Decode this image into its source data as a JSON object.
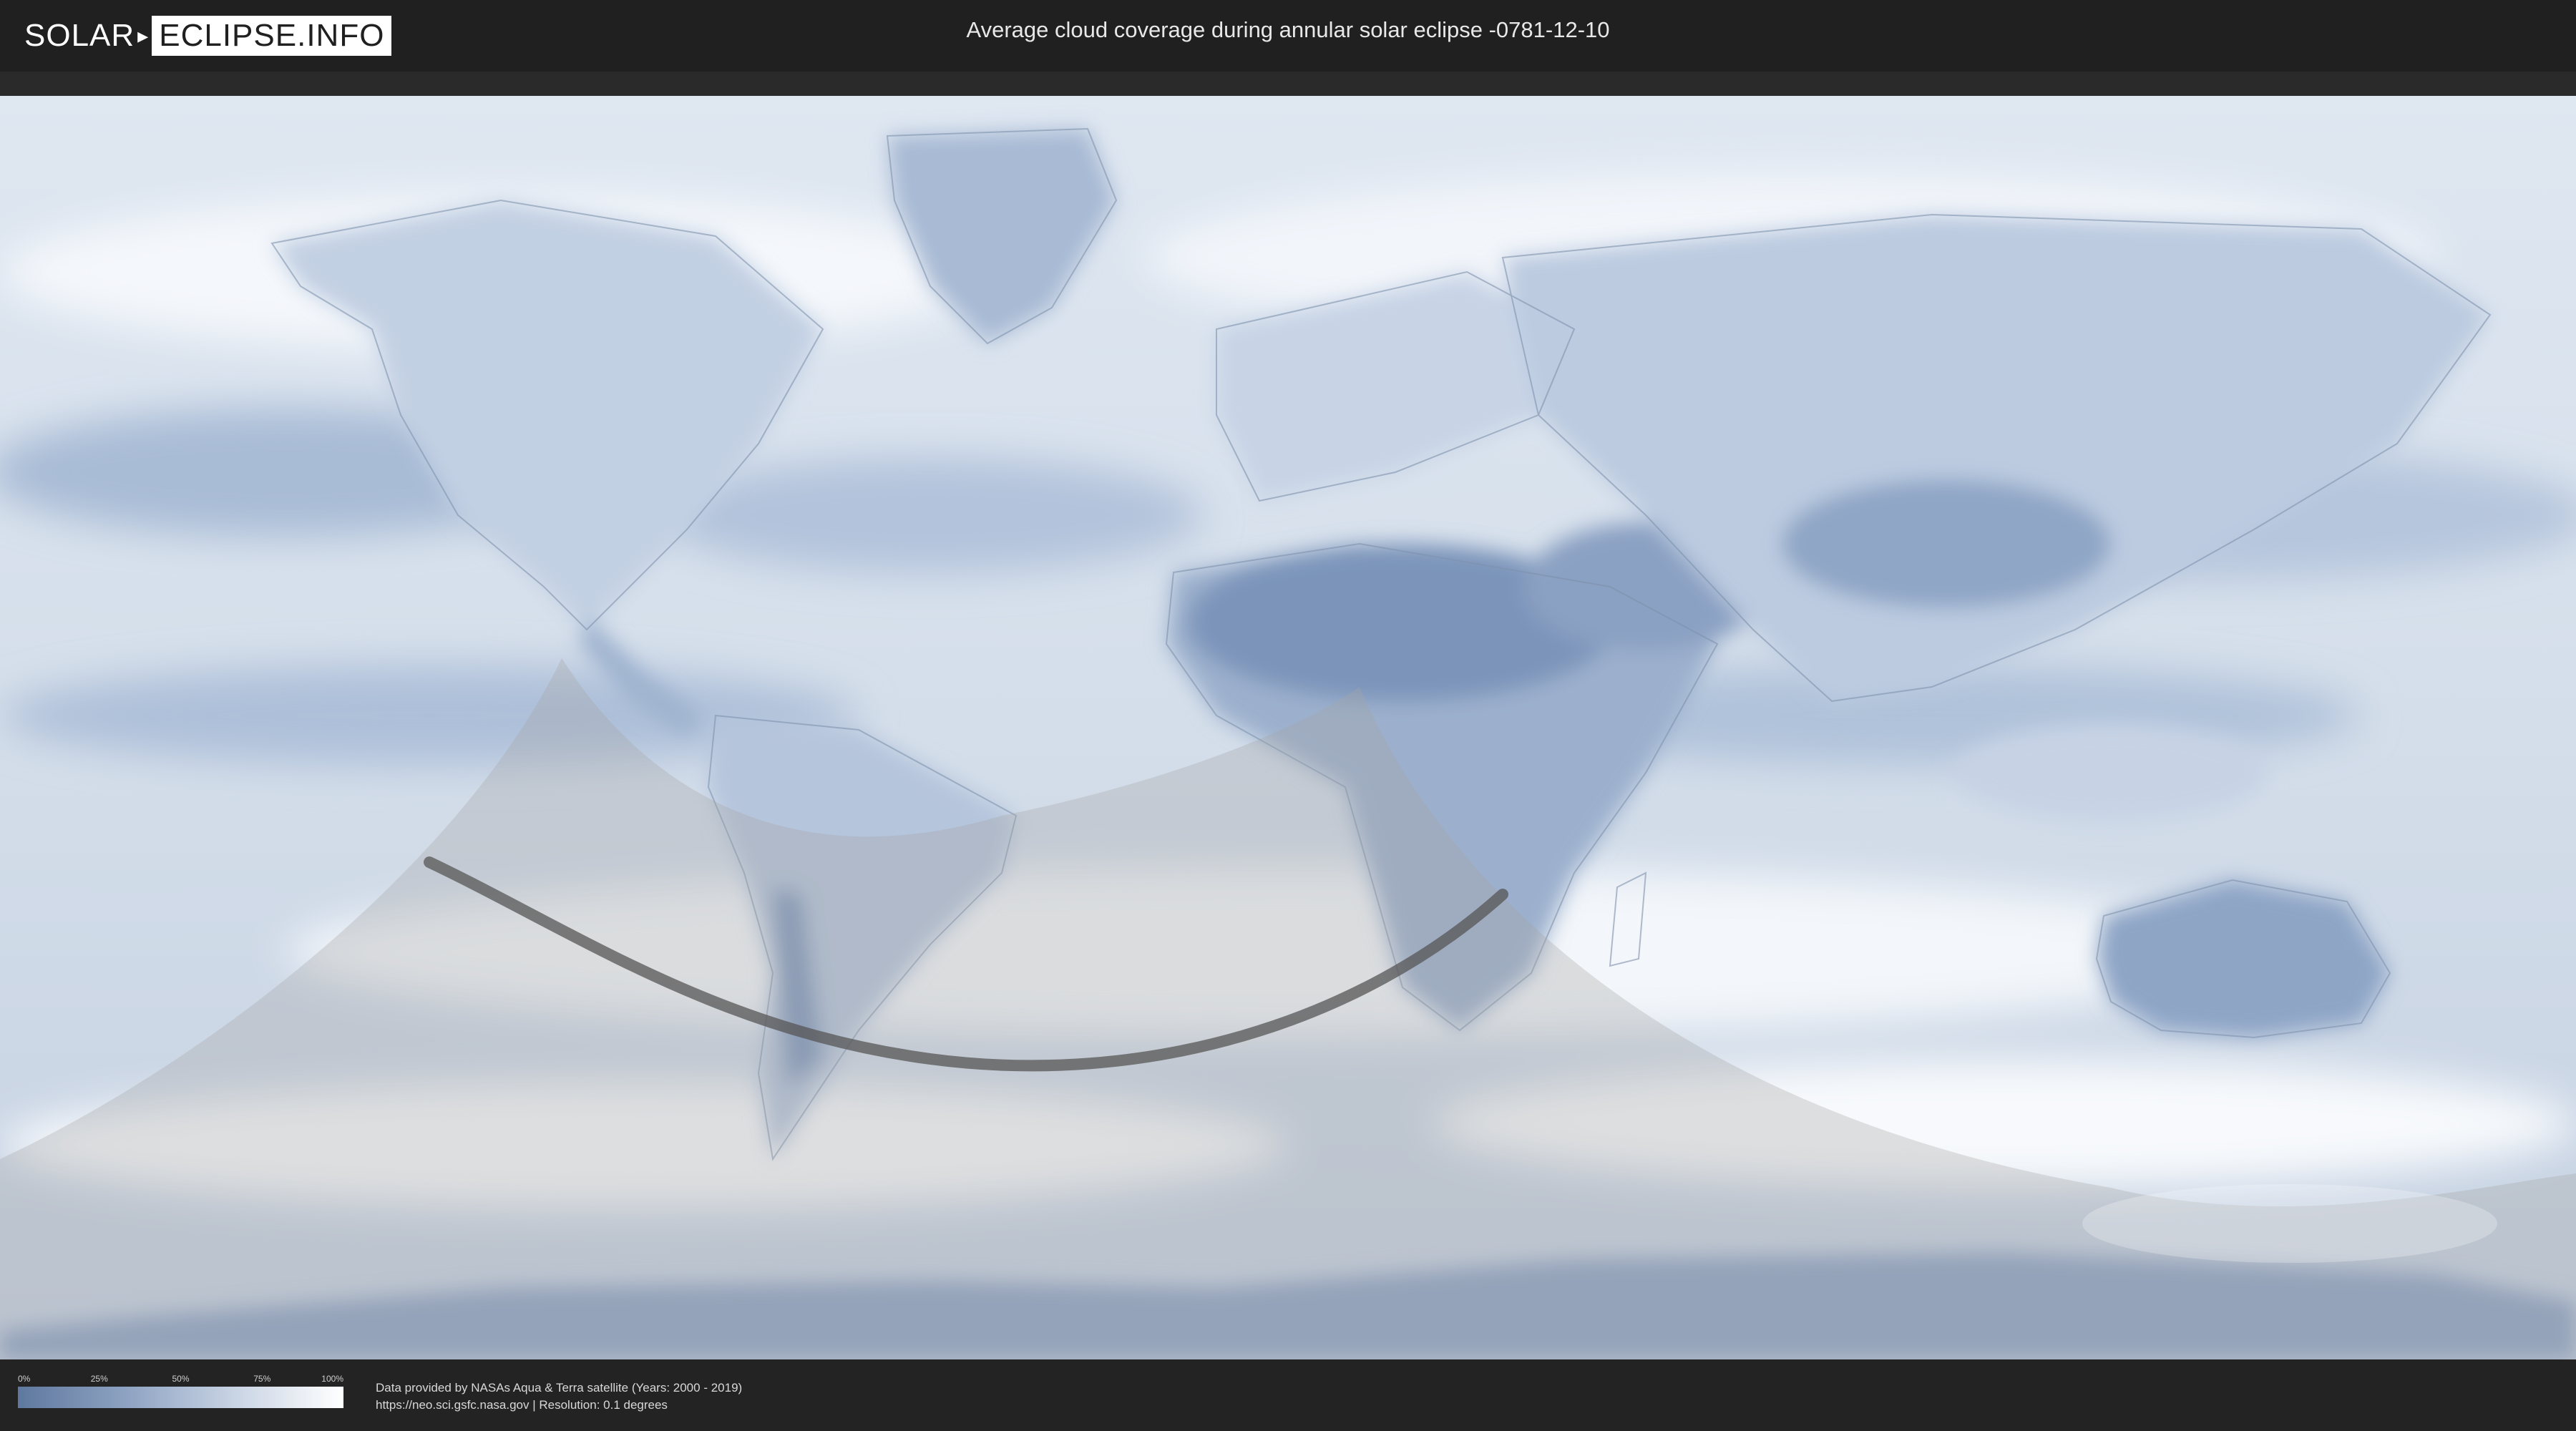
{
  "logo": {
    "part1": "SOLAR",
    "part2": "ECLIPSE.INFO"
  },
  "title": "Average cloud coverage during annular solar eclipse -0781-12-10",
  "legend": {
    "ticks": [
      "0%",
      "25%",
      "50%",
      "75%",
      "100%"
    ],
    "gradient_colors": [
      "#5f789f",
      "#8ea3c2",
      "#c9d4e4",
      "#ffffff"
    ]
  },
  "credits": {
    "line1": "Data provided by NASAs Aqua & Terra satellite (Years: 2000 - 2019)",
    "line2": "https://neo.sci.gsfc.nasa.gov | Resolution: 0.1 degrees"
  },
  "colors": {
    "header_bg": "#202020",
    "cloud_clear": "#6f87ad",
    "cloud_full": "#ffffff",
    "eclipse_shade": "#9a9a9a",
    "central_path": "#555555"
  }
}
